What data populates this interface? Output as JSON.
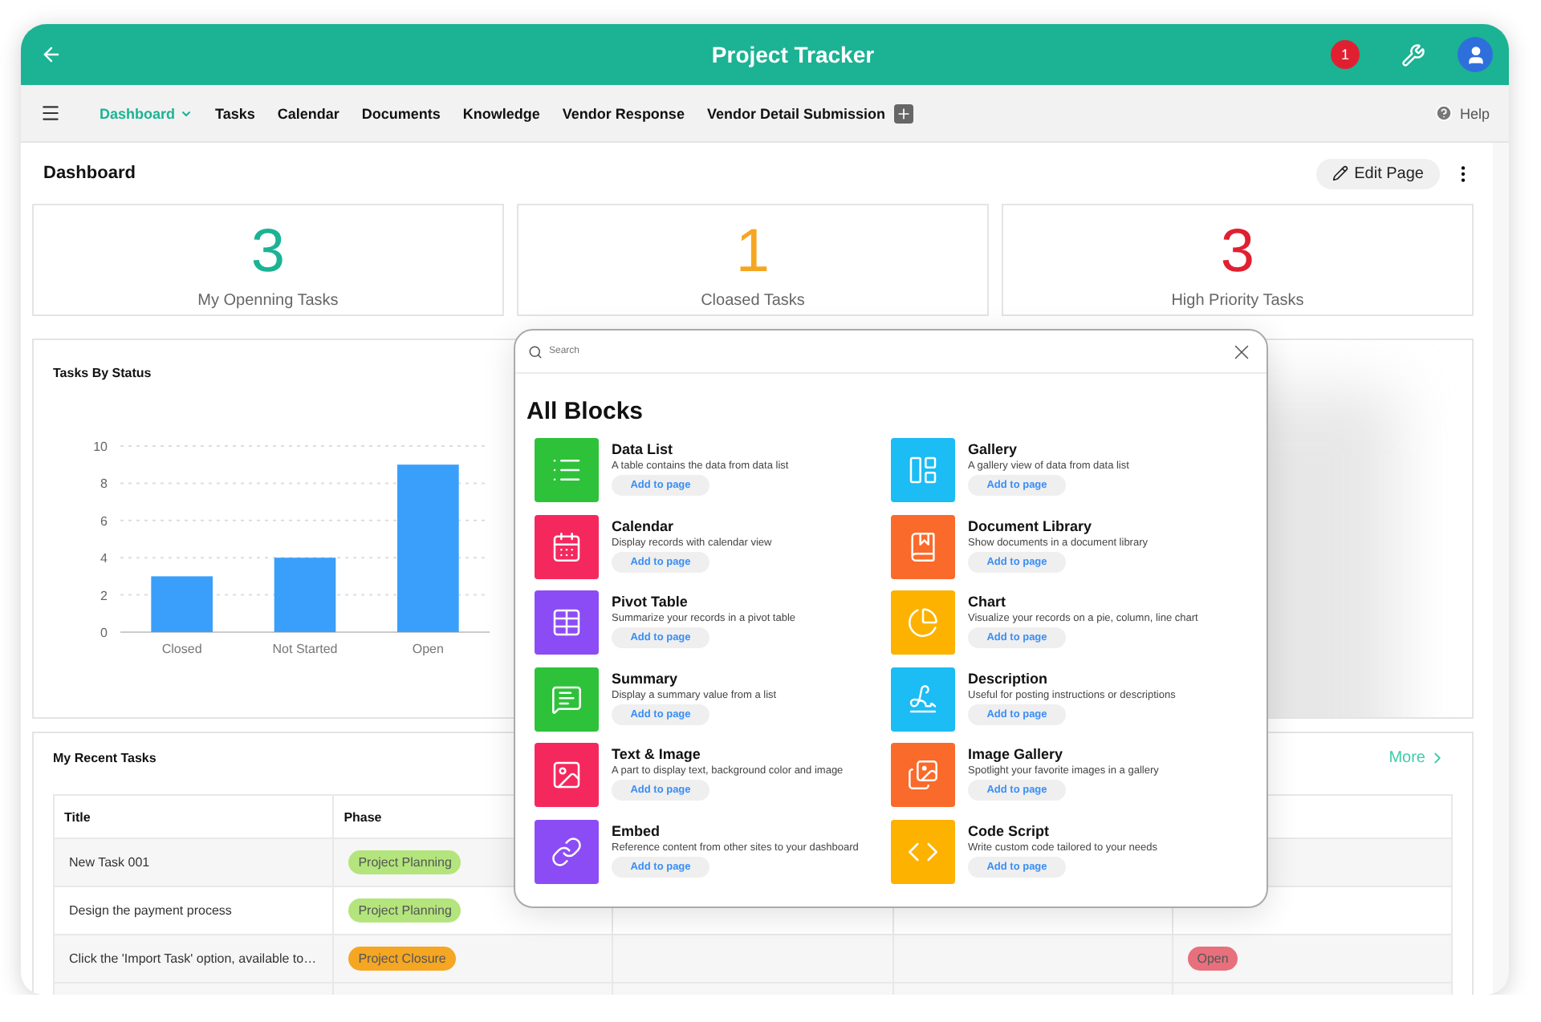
{
  "app_bar": {
    "title": "Project Tracker",
    "notification_count": "1"
  },
  "nav": {
    "items": [
      {
        "label": "Dashboard",
        "selected": true
      },
      {
        "label": "Tasks",
        "selected": false
      },
      {
        "label": "Calendar",
        "selected": false
      },
      {
        "label": "Documents",
        "selected": false
      },
      {
        "label": "Knowledge",
        "selected": false
      },
      {
        "label": "Vendor Response",
        "selected": false
      },
      {
        "label": "Vendor Detail Submission",
        "selected": false
      }
    ],
    "help": "Help"
  },
  "page": {
    "title": "Dashboard",
    "edit_button": "Edit Page"
  },
  "stats": [
    {
      "value": "3",
      "label": "My Openning Tasks",
      "color": "#1bb394"
    },
    {
      "value": "1",
      "label": "Cloased Tasks",
      "color": "#f5a623"
    },
    {
      "value": "3",
      "label": "High Priority Tasks",
      "color": "#e02030"
    }
  ],
  "status_chart": {
    "title": "Tasks By Status",
    "chart_data": {
      "type": "bar",
      "categories": [
        "Closed",
        "Not Started",
        "Open"
      ],
      "series": [
        {
          "color": "#3a9ffa",
          "values": [
            3,
            4,
            9
          ]
        }
      ],
      "ylim": [
        0,
        10
      ],
      "yticks": [
        0,
        2,
        4,
        6,
        8,
        10
      ],
      "grid": true
    }
  },
  "recent_tasks": {
    "title": "My Recent Tasks",
    "more": "More",
    "columns": [
      "Title",
      "Phase"
    ],
    "rows": [
      {
        "title": "New Task 001",
        "phase": "Project Planning",
        "color": "#b3e57c",
        "status": null
      },
      {
        "title": "Design the payment process",
        "phase": "Project Planning",
        "color": "#b3e57c",
        "status": null
      },
      {
        "title": "Click the 'Import Task' option, available to…",
        "phase": "Project Closure",
        "color": "#f5a623",
        "status": "Open"
      }
    ]
  },
  "blocks_dialog": {
    "search": {
      "placeholder": "Search"
    },
    "title": "All Blocks",
    "blocks": [
      {
        "kind": "list",
        "name": "Data List",
        "description": "A table contains the data from data list",
        "color": "#2ec23a",
        "button": "Add to page"
      },
      {
        "kind": "gallery",
        "name": "Gallery",
        "description": "A gallery view of data from data list",
        "color": "#1cbcf5",
        "button": "Add to page"
      },
      {
        "kind": "calendar",
        "name": "Calendar",
        "description": "Display records with calendar view",
        "color": "#f5285e",
        "button": "Add to page"
      },
      {
        "kind": "library",
        "name": "Document Library",
        "description": "Show documents in a document library",
        "color": "#fa6a2a",
        "button": "Add to page"
      },
      {
        "kind": "pivot",
        "name": "Pivot Table",
        "description": "Summarize your records in a pivot table",
        "color": "#8c4cf5",
        "button": "Add to page"
      },
      {
        "kind": "chart",
        "name": "Chart",
        "description": "Visualize your records on a pie, column, line chart",
        "color": "#fdb200",
        "button": "Add to page"
      },
      {
        "kind": "summary",
        "name": "Summary",
        "description": "Display a summary value from a list",
        "color": "#2ec23a",
        "button": "Add to page"
      },
      {
        "kind": "description",
        "name": "Description",
        "description": "Useful for posting instructions or descriptions",
        "color": "#1cbcf5",
        "button": "Add to page"
      },
      {
        "kind": "textimage",
        "name": "Text & Image",
        "description": "A part to display text, background color and image",
        "color": "#f5285e",
        "button": "Add to page"
      },
      {
        "kind": "imagegallery",
        "name": "Image Gallery",
        "description": "Spotlight your favorite images in a gallery",
        "color": "#fa6a2a",
        "button": "Add to page"
      },
      {
        "kind": "embed",
        "name": "Embed",
        "description": "Reference content from other sites to your dashboard",
        "color": "#8c4cf5",
        "button": "Add to page"
      },
      {
        "kind": "code",
        "name": "Code Script",
        "description": "Write custom code tailored to your needs",
        "color": "#fdb200",
        "button": "Add to page"
      }
    ]
  }
}
